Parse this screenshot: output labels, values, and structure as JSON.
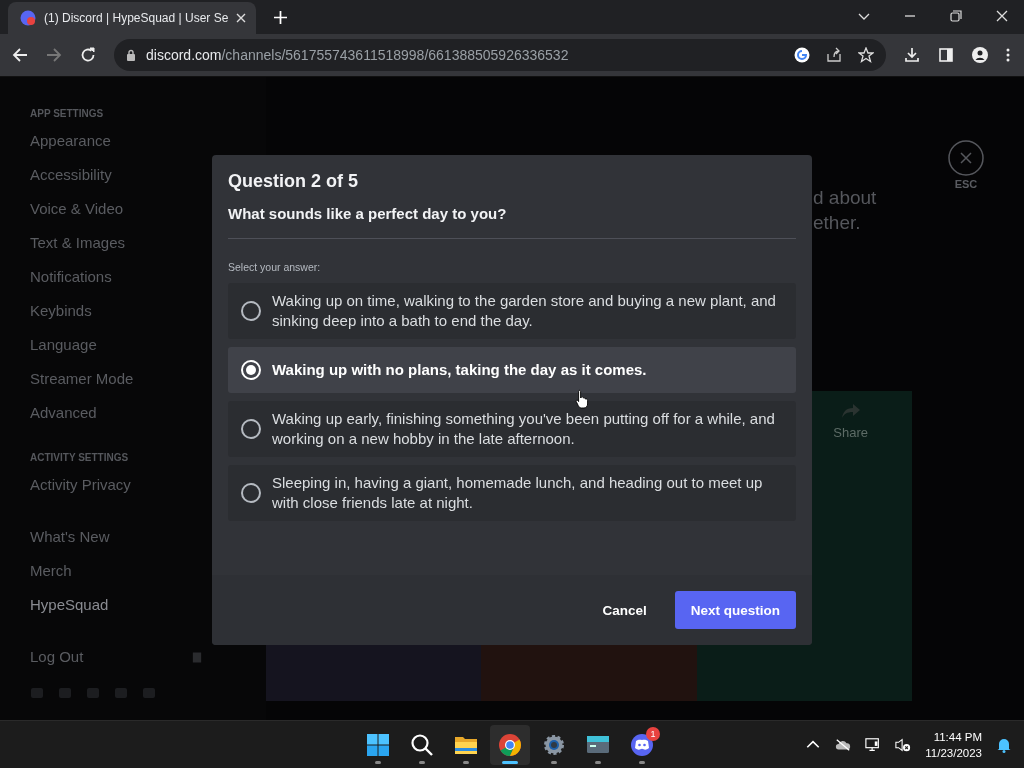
{
  "browser": {
    "tab": {
      "title": "(1) Discord | HypeSquad | User Se"
    },
    "url_host": "discord.com",
    "url_path": "/channels/561755743611518998/661388505926336532"
  },
  "sidebar": {
    "sections": [
      {
        "heading": "APP SETTINGS",
        "items": [
          {
            "label": "Appearance",
            "selected": false
          },
          {
            "label": "Accessibility",
            "selected": false
          },
          {
            "label": "Voice & Video",
            "selected": false
          },
          {
            "label": "Text & Images",
            "selected": false
          },
          {
            "label": "Notifications",
            "selected": false
          },
          {
            "label": "Keybinds",
            "selected": false
          },
          {
            "label": "Language",
            "selected": false
          },
          {
            "label": "Streamer Mode",
            "selected": false
          },
          {
            "label": "Advanced",
            "selected": false
          }
        ]
      },
      {
        "heading": "ACTIVITY SETTINGS",
        "items": [
          {
            "label": "Activity Privacy",
            "selected": false
          }
        ]
      },
      {
        "items": [
          {
            "label": "What's New",
            "selected": false
          },
          {
            "label": "Merch",
            "selected": false
          },
          {
            "label": "HypeSquad",
            "selected": true
          }
        ]
      }
    ],
    "logout": "Log Out"
  },
  "background": {
    "heading_lines": [
      "d about",
      "ether."
    ],
    "share": "Share",
    "close_hint": "ESC"
  },
  "modal": {
    "title": "Question 2 of 5",
    "question": "What sounds like a perfect day to you?",
    "prompt": "Select your answer:",
    "options": [
      {
        "text": "Waking up on time, walking to the garden store and buying a new plant, and sinking deep into a bath to end the day.",
        "selected": false
      },
      {
        "text": "Waking up with no plans, taking the day as it comes.",
        "selected": true
      },
      {
        "text": "Waking up early, finishing something you've been putting off for a while, and working on a new hobby in the late afternoon.",
        "selected": false
      },
      {
        "text": "Sleeping in, having a giant, homemade lunch, and heading out to meet up with close friends late at night.",
        "selected": false
      }
    ],
    "cancel": "Cancel",
    "next": "Next question"
  },
  "taskbar": {
    "apps": [
      {
        "kind": "start",
        "active": false
      },
      {
        "kind": "search",
        "active": false
      },
      {
        "kind": "folder",
        "active": false
      },
      {
        "kind": "browser",
        "active": true
      },
      {
        "kind": "settings",
        "active": false
      },
      {
        "kind": "terminal",
        "active": false
      },
      {
        "kind": "chat",
        "active": false,
        "badge": "1"
      }
    ],
    "time": "11:44 PM",
    "date": "11/23/2023"
  }
}
